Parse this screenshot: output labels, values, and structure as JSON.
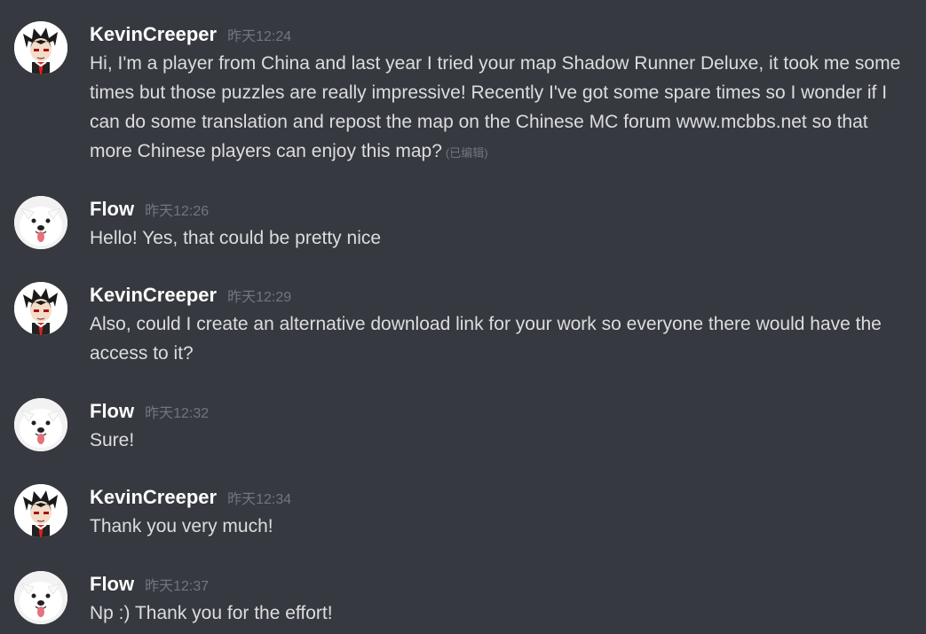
{
  "messages": [
    {
      "username": "KevinCreeper",
      "timestamp": "昨天12:24",
      "avatar": "anime-boy-avatar",
      "text": "Hi, I'm a player from China and last year I tried your map Shadow Runner Deluxe, it took me some times but those puzzles are really impressive! Recently I've got some spare times so I wonder if I can do some translation and repost the map on the Chinese MC forum www.mcbbs.net so that more Chinese players can enjoy this map?",
      "edited_label": "(已编辑)"
    },
    {
      "username": "Flow",
      "timestamp": "昨天12:26",
      "avatar": "samoyed-dog-avatar",
      "text": "Hello! Yes, that could be pretty nice"
    },
    {
      "username": "KevinCreeper",
      "timestamp": "昨天12:29",
      "avatar": "anime-boy-avatar",
      "text": "Also, could I create an alternative download link for your work so everyone there would have the access to it?"
    },
    {
      "username": "Flow",
      "timestamp": "昨天12:32",
      "avatar": "samoyed-dog-avatar",
      "text": "Sure!"
    },
    {
      "username": "KevinCreeper",
      "timestamp": "昨天12:34",
      "avatar": "anime-boy-avatar",
      "text": "Thank you very much!"
    },
    {
      "username": "Flow",
      "timestamp": "昨天12:37",
      "avatar": "samoyed-dog-avatar",
      "text": "Np :) Thank you for the effort!"
    }
  ]
}
